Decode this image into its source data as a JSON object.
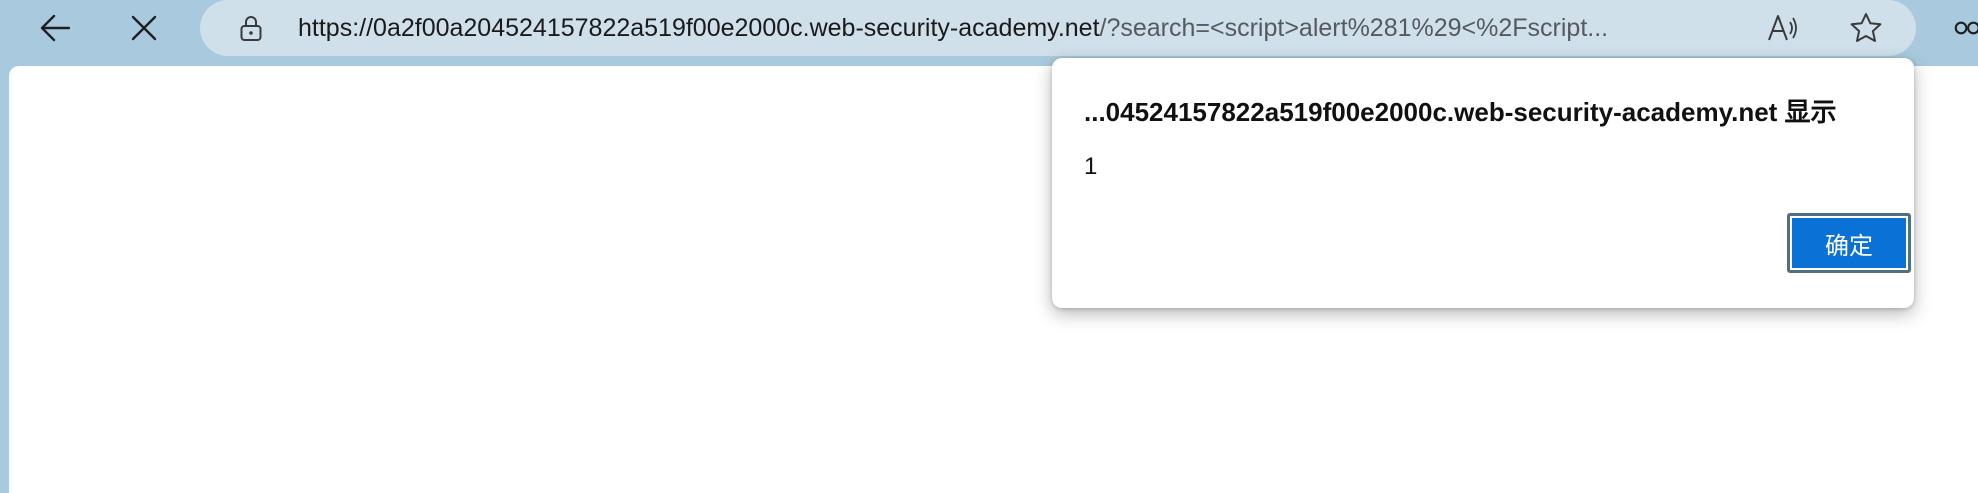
{
  "toolbar": {
    "back_icon": "back-arrow-icon",
    "stop_icon": "close-icon",
    "lock_icon": "lock-icon",
    "read_aloud_icon": "read-aloud-icon",
    "favorite_icon": "star-icon",
    "more_icon": "more-icon"
  },
  "address_bar": {
    "url_host": "https://0a2f00a204524157822a519f00e2000c.web-security-academy.net",
    "url_rest": "/?search=<script>alert%281%29<%2Fscript..."
  },
  "dialog": {
    "title": "...04524157822a519f00e2000c.web-security-academy.net 显示",
    "message": "1",
    "ok_label": "确定"
  },
  "colors": {
    "frame": "#a9cade",
    "address_bar": "#cfe0eb",
    "button": "#0a71d6"
  }
}
